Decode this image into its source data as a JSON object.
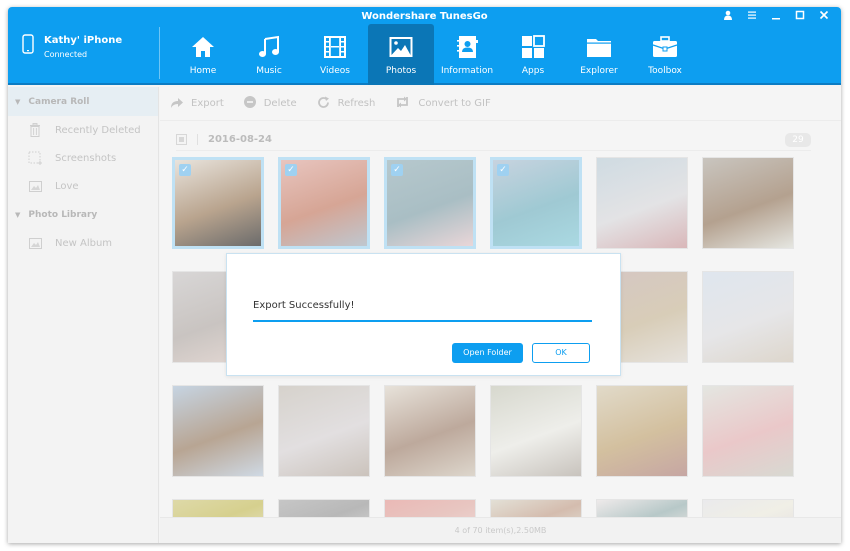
{
  "window": {
    "title": "Wondershare TunesGo",
    "controls": [
      "user-icon",
      "menu-icon",
      "minimize-icon",
      "maximize-icon",
      "close-icon"
    ]
  },
  "device": {
    "name": "Kathy' iPhone",
    "status": "Connected",
    "icon": "phone-icon"
  },
  "nav": {
    "active": "Photos",
    "items": [
      {
        "label": "Home",
        "icon": "home-icon"
      },
      {
        "label": "Music",
        "icon": "music-icon"
      },
      {
        "label": "Videos",
        "icon": "film-icon"
      },
      {
        "label": "Photos",
        "icon": "image-icon"
      },
      {
        "label": "Information",
        "icon": "contacts-icon"
      },
      {
        "label": "Apps",
        "icon": "apps-icon"
      },
      {
        "label": "Explorer",
        "icon": "folder-icon"
      },
      {
        "label": "Toolbox",
        "icon": "toolbox-icon"
      }
    ]
  },
  "sidebar": {
    "sections": [
      {
        "label": "Camera Roll",
        "selected": true,
        "items": [
          {
            "label": "Recently Deleted",
            "icon": "trash-icon"
          },
          {
            "label": "Screenshots",
            "icon": "screenshot-icon"
          },
          {
            "label": "Love",
            "icon": "album-icon"
          }
        ]
      },
      {
        "label": "Photo Library",
        "selected": false,
        "items": [
          {
            "label": "New Album",
            "icon": "album-icon"
          }
        ]
      }
    ]
  },
  "toolbar": {
    "export": "Export",
    "delete": "Delete",
    "refresh": "Refresh",
    "convert": "Convert to GIF"
  },
  "gallery": {
    "date": "2016-08-24",
    "count": "29",
    "photos": [
      {
        "selected": true,
        "colors": [
          "#e8e3dc",
          "#b9a48e",
          "#6b6b6b"
        ]
      },
      {
        "selected": true,
        "colors": [
          "#e8c5bf",
          "#d6a595",
          "#bfc7cf"
        ]
      },
      {
        "selected": true,
        "colors": [
          "#b6c8cd",
          "#a9bec4",
          "#e9d6d8"
        ]
      },
      {
        "selected": true,
        "colors": [
          "#c7d3df",
          "#9fc9d3",
          "#aad9e2"
        ]
      },
      {
        "selected": false,
        "colors": [
          "#cfdbe2",
          "#e3e3e5",
          "#d9b7b9"
        ]
      },
      {
        "selected": false,
        "colors": [
          "#c9c5bf",
          "#b4a18f",
          "#e5e6e1"
        ]
      },
      {
        "selected": false,
        "colors": [
          "#d8d6d6",
          "#c9c4c1",
          "#e5d9d4"
        ]
      },
      {
        "selected": false,
        "colors": [
          "#d3cfca",
          "#c4bdb6",
          "#ddd6d2"
        ]
      },
      {
        "selected": false,
        "colors": [
          "#ddd6cc",
          "#cfc5b9",
          "#e4ddd4"
        ]
      },
      {
        "selected": false,
        "colors": [
          "#d8d4ce",
          "#c7c0b7",
          "#e2ddd6"
        ]
      },
      {
        "selected": false,
        "colors": [
          "#d5c7c3",
          "#d8cdb8",
          "#e6e2dc"
        ]
      },
      {
        "selected": false,
        "colors": [
          "#dfe6ee",
          "#e6e6e8",
          "#ddd6cc"
        ]
      },
      {
        "selected": false,
        "colors": [
          "#c6d4e2",
          "#b8a593",
          "#cfd9e4"
        ]
      },
      {
        "selected": false,
        "colors": [
          "#d6d2cc",
          "#e2dfe0",
          "#cbc3bc"
        ]
      },
      {
        "selected": false,
        "colors": [
          "#e7e2da",
          "#bda99c",
          "#ddd6cc"
        ]
      },
      {
        "selected": false,
        "colors": [
          "#d7d8ce",
          "#eeeeea",
          "#c8c3bd"
        ]
      },
      {
        "selected": false,
        "colors": [
          "#e1dac9",
          "#d3c09f",
          "#c6a6a3"
        ]
      },
      {
        "selected": false,
        "colors": [
          "#e4e6e1",
          "#eac8c9",
          "#d8d9d2"
        ]
      },
      {
        "selected": false,
        "colors": [
          "#ded9a8",
          "#d6d08e",
          "#e3dfbd"
        ]
      },
      {
        "selected": false,
        "colors": [
          "#c6c6c6",
          "#b8b8b8",
          "#d2d2d2"
        ]
      },
      {
        "selected": false,
        "colors": [
          "#eab9b6",
          "#e8c6c1",
          "#edd6d3"
        ]
      },
      {
        "selected": false,
        "colors": [
          "#e3e0d6",
          "#d4bcae",
          "#e0ded5"
        ]
      },
      {
        "selected": false,
        "colors": [
          "#eeeaea",
          "#b7c8c8",
          "#e8e4e2"
        ]
      },
      {
        "selected": false,
        "colors": [
          "#eaeaec",
          "#f0efe6",
          "#e6e1e2"
        ]
      }
    ]
  },
  "status": "4 of 70 item(s),2.50MB",
  "dialog": {
    "message": "Export Successfully!",
    "progress_percent": 100,
    "open_folder": "Open Folder",
    "ok": "OK"
  },
  "colors": {
    "accent": "#0d9ef0",
    "nav_active": "#0b76b6"
  }
}
